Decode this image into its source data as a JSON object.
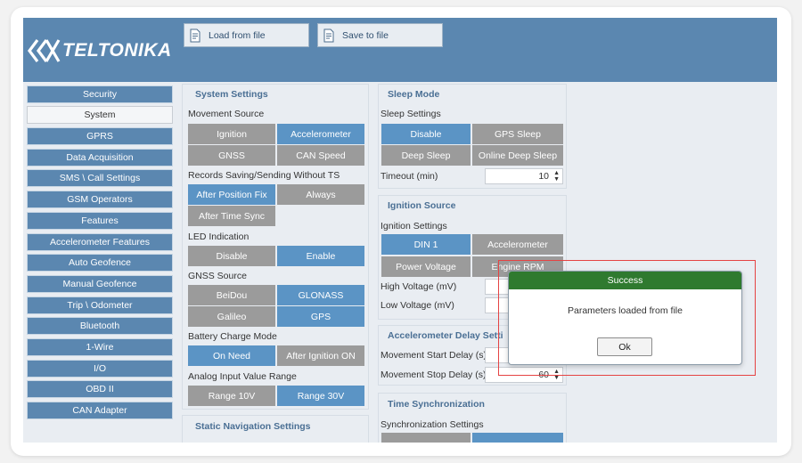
{
  "header": {
    "logo_text": "TELTONIKA",
    "load_label": "Load from file",
    "save_label": "Save to file"
  },
  "sidebar": {
    "items": [
      {
        "label": "Security"
      },
      {
        "label": "System",
        "active": true
      },
      {
        "label": "GPRS"
      },
      {
        "label": "Data Acquisition"
      },
      {
        "label": "SMS \\ Call Settings"
      },
      {
        "label": "GSM Operators"
      },
      {
        "label": "Features"
      },
      {
        "label": "Accelerometer Features"
      },
      {
        "label": "Auto Geofence"
      },
      {
        "label": "Manual Geofence"
      },
      {
        "label": "Trip \\ Odometer"
      },
      {
        "label": "Bluetooth"
      },
      {
        "label": "1-Wire"
      },
      {
        "label": "I/O"
      },
      {
        "label": "OBD II"
      },
      {
        "label": "CAN Adapter"
      }
    ]
  },
  "system_settings": {
    "title": "System Settings",
    "movement_source": {
      "label": "Movement Source",
      "options": [
        "Ignition",
        "Accelerometer",
        "GNSS",
        "CAN Speed"
      ],
      "selected": [
        "Accelerometer"
      ]
    },
    "records": {
      "label": "Records Saving/Sending Without TS",
      "options": [
        "After Position Fix",
        "Always",
        "After Time Sync"
      ],
      "selected": [
        "After Position Fix"
      ]
    },
    "led": {
      "label": "LED Indication",
      "options": [
        "Disable",
        "Enable"
      ],
      "selected": [
        "Enable"
      ]
    },
    "gnss_source": {
      "label": "GNSS Source",
      "options": [
        "BeiDou",
        "GLONASS",
        "Galileo",
        "GPS"
      ],
      "selected": [
        "GLONASS",
        "GPS"
      ]
    },
    "battery": {
      "label": "Battery Charge Mode",
      "options": [
        "On Need",
        "After Ignition ON"
      ],
      "selected": [
        "On Need"
      ]
    },
    "analog": {
      "label": "Analog Input Value Range",
      "options": [
        "Range 10V",
        "Range 30V"
      ],
      "selected": [
        "Range 30V"
      ]
    }
  },
  "static_nav": {
    "title": "Static Navigation Settings"
  },
  "sleep_mode": {
    "title": "Sleep Mode",
    "settings_label": "Sleep Settings",
    "options": [
      "Disable",
      "GPS Sleep",
      "Deep Sleep",
      "Online Deep Sleep"
    ],
    "selected": [
      "Disable"
    ],
    "timeout_label": "Timeout (min)",
    "timeout_value": "10"
  },
  "ignition_source": {
    "title": "Ignition Source",
    "settings_label": "Ignition Settings",
    "options": [
      "DIN 1",
      "Accelerometer",
      "Power Voltage",
      "Engine RPM"
    ],
    "selected": [
      "DIN 1"
    ],
    "high_voltage_label": "High Voltage (mV)",
    "low_voltage_label": "Low Voltage (mV)"
  },
  "accel_delay": {
    "title": "Accelerometer Delay Setti",
    "start_label": "Movement Start Delay (s)",
    "stop_label": "Movement Stop Delay (s)",
    "stop_value": "60"
  },
  "time_sync": {
    "title": "Time Synchronization",
    "settings_label": "Synchronization Settings"
  },
  "dialog": {
    "title": "Success",
    "message": "Parameters loaded from file",
    "ok_label": "Ok",
    "title_color": "#2f7a2f"
  },
  "colors": {
    "header": "#5b87b0",
    "toggle_on": "#5b94c5",
    "toggle_off": "#9b9b9b",
    "highlight": "#e54343"
  }
}
